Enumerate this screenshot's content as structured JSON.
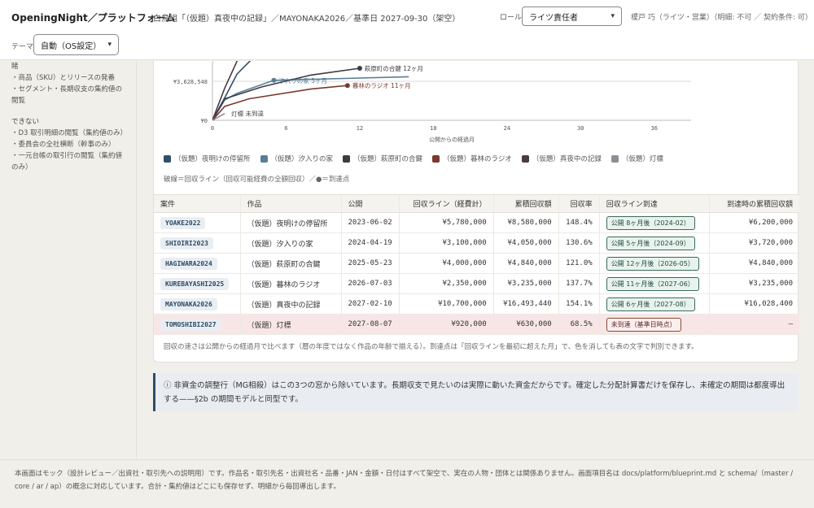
{
  "header": {
    "brand": "OpeningNight／プラットフォーム",
    "breadcrumb": "白鳥組「（仮題）真夜中の記録」／MAYONAKA2026／基準日 2027-09-30（架空）",
    "role_label": "ロール",
    "role_value": "ライツ責任者",
    "user_info": "榎戸 巧（ライツ・営業）（明細: 不可 ／ 契約条件: 可）",
    "theme_label": "テーマ",
    "theme_value": "自動（OS設定）"
  },
  "sidebar": {
    "lines_top": [
      "睹",
      "・商品（SKU）とリリースの発番",
      "・セグメント・長期収支の集約値の閲覧"
    ],
    "cannot_heading": "できない",
    "lines_cannot": [
      "・D3 取引明細の閲覧（集約値のみ）",
      "・委員会の全社横断（幹事のみ）",
      "・一元台帳の取引行の閲覧（集約値のみ）"
    ]
  },
  "chart_data": {
    "type": "line",
    "xlabel": "公開からの経過月",
    "x_ticks": [
      0,
      6,
      12,
      18,
      24,
      30,
      36
    ],
    "y_ticks": [
      "¥0",
      "¥3,628,548"
    ],
    "xlim": [
      0,
      39
    ],
    "series": [
      {
        "name": "（仮題）夜明けの停留所",
        "color": "#2f4e6a",
        "points": [
          [
            0,
            0
          ],
          [
            1,
            2100000
          ],
          [
            2,
            4300000
          ],
          [
            4,
            6600000
          ],
          [
            6,
            8580000
          ]
        ]
      },
      {
        "name": "（仮題）汐入りの家",
        "color": "#5a7d96",
        "points": [
          [
            0,
            0
          ],
          [
            1,
            1900000
          ],
          [
            2,
            2500000
          ],
          [
            5,
            3720000
          ],
          [
            16,
            4050000
          ]
        ]
      },
      {
        "name": "（仮題）萩原町の合鍵",
        "color": "#3b3b40",
        "points": [
          [
            0,
            0
          ],
          [
            1,
            2000000
          ],
          [
            4,
            3100000
          ],
          [
            8,
            4200000
          ],
          [
            12,
            4840000
          ]
        ]
      },
      {
        "name": "（仮題）暮林のラジオ",
        "color": "#7a3a2e",
        "points": [
          [
            0,
            0
          ],
          [
            1,
            1300000
          ],
          [
            3,
            2000000
          ],
          [
            8,
            2900000
          ],
          [
            11,
            3235000
          ]
        ]
      },
      {
        "name": "（仮題）真夜中の記録",
        "color": "#4a3a48",
        "points": [
          [
            0,
            0
          ],
          [
            1,
            3000000
          ],
          [
            2,
            5500000
          ],
          [
            4,
            9000000
          ],
          [
            6,
            12500000
          ],
          [
            8,
            16493440
          ]
        ]
      },
      {
        "name": "（仮題）灯標",
        "color": "#8a8f94",
        "points": [
          [
            0,
            0
          ],
          [
            1,
            630000
          ]
        ]
      }
    ],
    "markers": [
      {
        "label": "萩原町の合鍵 12ヶ月",
        "x": 12,
        "y": 4840000
      },
      {
        "label": "汐入りの家 5ヶ月",
        "x": 5,
        "y": 3720000
      },
      {
        "label": "暮林のラジオ 11ヶ月",
        "x": 11,
        "y": 3235000
      },
      {
        "label": "灯標 未到達",
        "x": 1,
        "y": 630000
      }
    ]
  },
  "legend": [
    {
      "label": "（仮題）夜明けの停留所",
      "color": "#2f4e6a"
    },
    {
      "label": "（仮題）汐入りの家",
      "color": "#5a7d96"
    },
    {
      "label": "（仮題）萩原町の合鍵",
      "color": "#3b3b40"
    },
    {
      "label": "（仮題）暮林のラジオ",
      "color": "#7a3a2e"
    },
    {
      "label": "（仮題）真夜中の記録",
      "color": "#4a3a48"
    },
    {
      "label": "（仮題）灯標",
      "color": "#8a8f94"
    }
  ],
  "chart_note": "破線＝回収ライン（回収可能経費の全額回収）／●＝到達点",
  "table": {
    "headers": [
      "案件",
      "作品",
      "公開",
      "回収ライン（経費計）",
      "累積回収額",
      "回収率",
      "回収ライン到達",
      "到達時の累積回収額"
    ],
    "rows": [
      {
        "code": "YOAKE2022",
        "title": "（仮題）夜明けの停留所",
        "release": "2023-06-02",
        "line": "¥5,780,000",
        "cumulative": "¥8,580,000",
        "rate": "148.4%",
        "status": "公開 8ヶ月後（2024-02）",
        "at_reach": "¥6,200,000",
        "pending": false
      },
      {
        "code": "SHIOIRI2023",
        "title": "（仮題）汐入りの家",
        "release": "2024-04-19",
        "line": "¥3,100,000",
        "cumulative": "¥4,050,000",
        "rate": "130.6%",
        "status": "公開 5ヶ月後（2024-09）",
        "at_reach": "¥3,720,000",
        "pending": false
      },
      {
        "code": "HAGIWARA2024",
        "title": "（仮題）萩原町の合鍵",
        "release": "2025-05-23",
        "line": "¥4,000,000",
        "cumulative": "¥4,840,000",
        "rate": "121.0%",
        "status": "公開 12ヶ月後（2026-05）",
        "at_reach": "¥4,840,000",
        "pending": false
      },
      {
        "code": "KUREBAYASHI2025",
        "title": "（仮題）暮林のラジオ",
        "release": "2026-07-03",
        "line": "¥2,350,000",
        "cumulative": "¥3,235,000",
        "rate": "137.7%",
        "status": "公開 11ヶ月後（2027-06）",
        "at_reach": "¥3,235,000",
        "pending": false
      },
      {
        "code": "MAYONAKA2026",
        "title": "（仮題）真夜中の記録",
        "release": "2027-02-10",
        "line": "¥10,700,000",
        "cumulative": "¥16,493,440",
        "rate": "154.1%",
        "status": "公開 6ヶ月後（2027-08）",
        "at_reach": "¥16,028,400",
        "pending": false
      },
      {
        "code": "TOMOSHIBI2027",
        "title": "（仮題）灯標",
        "release": "2027-08-07",
        "line": "¥920,000",
        "cumulative": "¥630,000",
        "rate": "68.5%",
        "status": "未到達（基準日時点）",
        "at_reach": "—",
        "pending": true
      }
    ]
  },
  "table_note": "回収の速さは公開からの経過月で比べます（暦の年度ではなく作品の年齢で揃える）。到達点は「回収ラインを最初に超えた月」で、色を消しても表の文字で判別できます。",
  "info": {
    "icon": "info-icon",
    "text": "非資金の調整行（MG相殺）はこの3つの窓から除いています。長期収支で見たいのは実際に動いた資金だからです。確定した分配計算書だけを保存し、未確定の期間は都度導出する——§2b の期間モデルと同型です。"
  },
  "footer": {
    "text": "本画面はモック（設計レビュー／出資社・取引先への説明用）です。作品名・取引先名・出資社名・品番・JAN・金額・日付はすべて架空で、実在の人物・団体とは関係ありません。画面項目名は docs/platform/blueprint.md と schema/（master / core / ar / ap）の概念に対応しています。合計・集約値はどこにも保存せず、明細から毎回導出します。"
  }
}
